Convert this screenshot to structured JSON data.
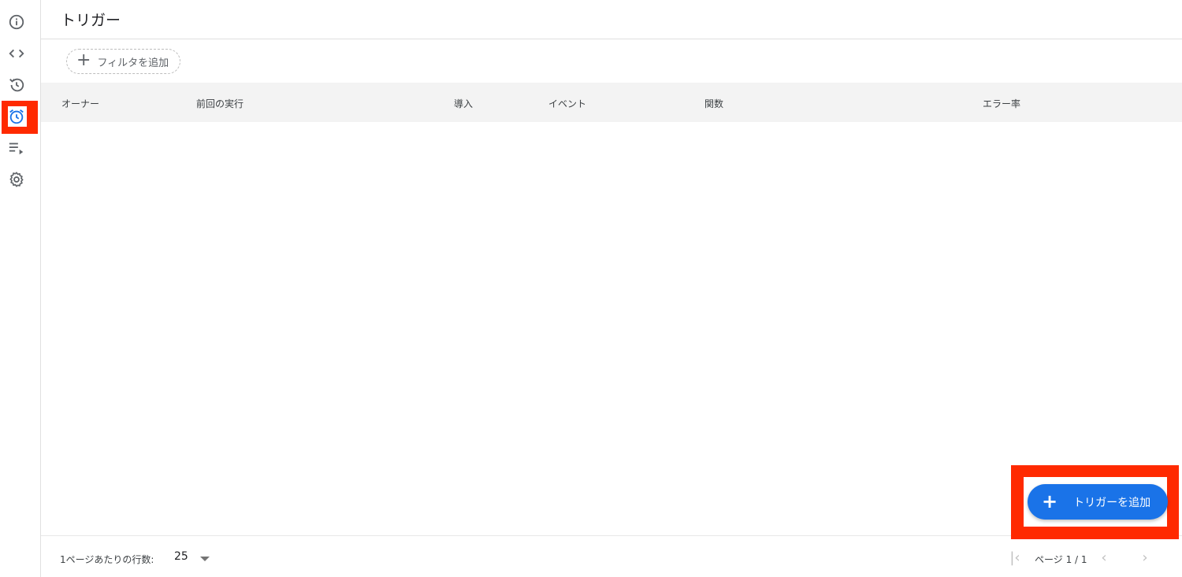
{
  "sidebar": {
    "items": [
      {
        "icon": "info-icon"
      },
      {
        "icon": "code-icon"
      },
      {
        "icon": "history-icon"
      },
      {
        "icon": "alarm-clock-icon",
        "active": true
      },
      {
        "icon": "playlist-play-icon"
      },
      {
        "icon": "gear-icon"
      }
    ],
    "active_color": "#1a73e8",
    "highlight_color": "#ff2a00"
  },
  "header": {
    "title": "トリガー"
  },
  "filter": {
    "add_label": "フィルタを追加"
  },
  "table": {
    "columns": [
      "オーナー",
      "前回の実行",
      "導入",
      "イベント",
      "関数",
      "エラー率"
    ],
    "rows": []
  },
  "footer": {
    "rows_per_page_label": "1ページあたりの行数:",
    "rows_per_page_value": "25",
    "page_info": "ページ 1 / 1"
  },
  "fab": {
    "label": "トリガーを追加",
    "color": "#1a73e8"
  }
}
